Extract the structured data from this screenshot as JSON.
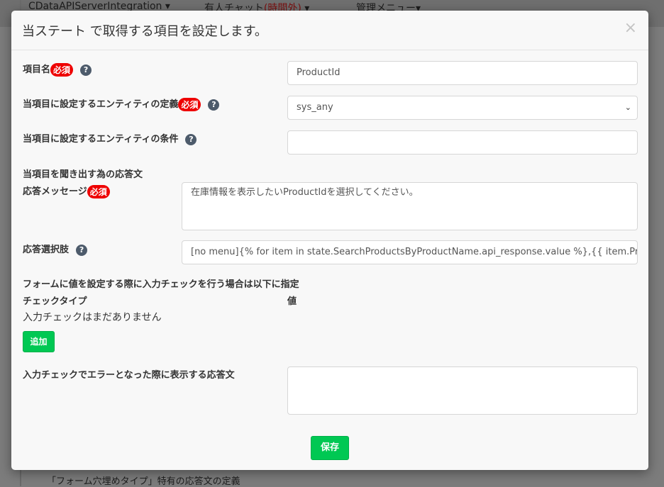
{
  "topbar": {
    "project": "CDataAPIServerIntegration ▾",
    "chat": "有人チャット",
    "chat_status": "(時間外)",
    "chat_caret": "▾",
    "admin": "管理メニュー▾"
  },
  "background": {
    "text": "「フォーム穴埋めタイプ」特有の応答文の定義"
  },
  "modal": {
    "title": "当ステート で取得する項目を設定します。",
    "close": "×",
    "required": "必須",
    "help": "?",
    "item_name_label": "項目名",
    "item_name_value": "ProductId",
    "entity_def_label": "当項目に設定するエンティティの定義",
    "entity_def_value": "sys_any",
    "entity_cond_label": "当項目に設定するエンティティの条件",
    "entity_cond_value": "",
    "response_section": "当項目を聞き出す為の応答文",
    "response_msg_label": "応答メッセージ",
    "response_msg_value": "在庫情報を表示したいProductIdを選択してください。",
    "options_label": "応答選択肢",
    "options_value": "[no menu]{% for item in state.SearchProductsByProductName.api_response.value %},{{ item.ProductID",
    "check_section": "フォームに値を設定する際に入力チェックを行う場合は以下に指定",
    "col_type": "チェックタイプ",
    "col_value": "値",
    "no_checks": "入力チェックはまだありません",
    "add": "追加",
    "error_label": "入力チェックでエラーとなった際に表示する応答文",
    "error_value": "",
    "save": "保存"
  }
}
